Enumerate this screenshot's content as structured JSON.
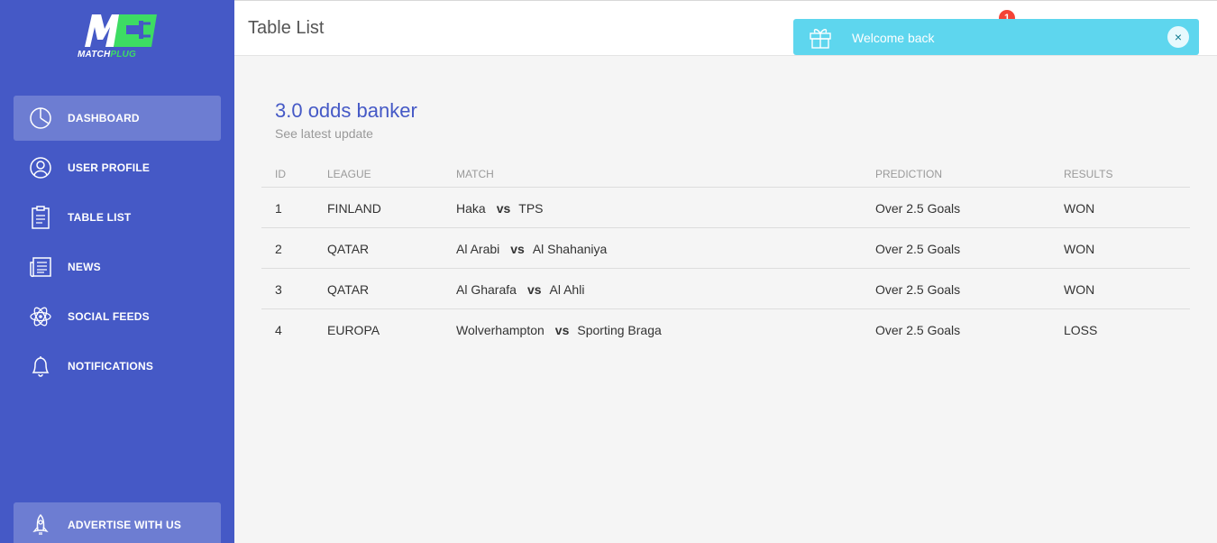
{
  "brand": {
    "text_main": "MATCH",
    "text_accent": "PLUG",
    "primary": "#4559c6",
    "accent": "#3ddc63"
  },
  "sidebar": {
    "items": [
      {
        "label": "DASHBOARD",
        "icon": "pie-chart-icon",
        "active": true
      },
      {
        "label": "USER PROFILE",
        "icon": "user-icon"
      },
      {
        "label": "TABLE LIST",
        "icon": "clipboard-icon"
      },
      {
        "label": "NEWS",
        "icon": "newspaper-icon"
      },
      {
        "label": "SOCIAL FEEDS",
        "icon": "atom-icon"
      },
      {
        "label": "NOTIFICATIONS",
        "icon": "bell-icon"
      }
    ],
    "bottom": {
      "label": "ADVERTISE WITH US",
      "icon": "rocket-icon"
    }
  },
  "header": {
    "title": "Table List",
    "notification_count": "1"
  },
  "toast": {
    "message": "Welcome back",
    "close": "×",
    "icon": "gift-icon",
    "color": "#5ed6ee"
  },
  "card": {
    "title": "3.0 odds banker",
    "subtitle": "See latest update",
    "columns": [
      "ID",
      "LEAGUE",
      "MATCH",
      "PREDICTION",
      "RESULTS"
    ],
    "vs_label": "vs",
    "rows": [
      {
        "id": "1",
        "league": "FINLAND",
        "home": "Haka",
        "away": "TPS",
        "prediction": "Over 2.5 Goals",
        "result": "WON"
      },
      {
        "id": "2",
        "league": "QATAR",
        "home": "Al Arabi",
        "away": "Al Shahaniya",
        "prediction": "Over 2.5 Goals",
        "result": "WON"
      },
      {
        "id": "3",
        "league": "QATAR",
        "home": "Al Gharafa",
        "away": "Al Ahli",
        "prediction": "Over 2.5 Goals",
        "result": "WON"
      },
      {
        "id": "4",
        "league": "EUROPA",
        "home": "Wolverhampton",
        "away": "Sporting Braga",
        "prediction": "Over 2.5 Goals",
        "result": "LOSS"
      }
    ]
  }
}
